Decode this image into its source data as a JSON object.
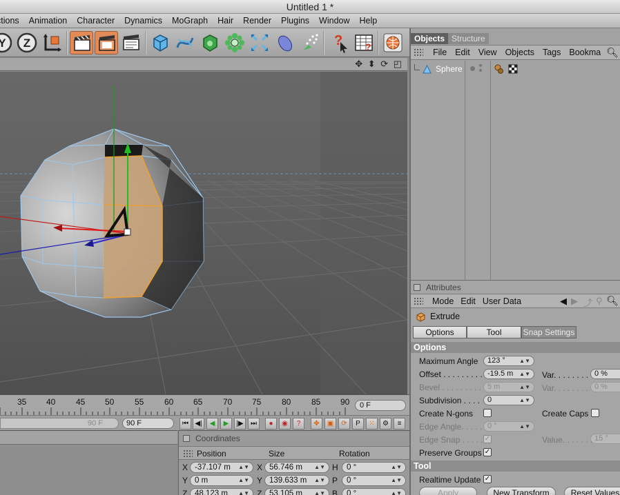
{
  "window": {
    "title": "Untitled 1 *"
  },
  "menubar": [
    "ctions",
    "Animation",
    "Character",
    "Dynamics",
    "MoGraph",
    "Hair",
    "Render",
    "Plugins",
    "Window",
    "Help"
  ],
  "toolbar": {
    "icons": [
      "y-axis-lock-icon",
      "z-axis-lock-icon",
      "world-coordinates-icon",
      "render-view-icon",
      "render-picture-viewer-icon",
      "render-settings-icon",
      "cube-primitive-icon",
      "spline-icon",
      "nurbs-icon",
      "array-icon",
      "deformer-icon",
      "scene-icon",
      "light-icon",
      "help-pointer-icon",
      "layout-icon",
      "web-icon"
    ],
    "y_label": "Y",
    "z_label": "Z"
  },
  "viewport": {
    "nav_icons": "✥ ⬍ ⟳ ◰"
  },
  "timeline": {
    "ticks": [
      "35",
      "40",
      "45",
      "50",
      "55",
      "60",
      "65",
      "70",
      "75",
      "80",
      "85",
      "90"
    ],
    "current_frame": "0 F",
    "slider_value": "90 F",
    "end_frame": "90 F"
  },
  "coordinates": {
    "title": "Coordinates",
    "headers": {
      "position": "Position",
      "size": "Size",
      "rotation": "Rotation"
    },
    "rows": [
      {
        "axis": "X",
        "position": "-37.107 m",
        "size_axis": "X",
        "size": "56.746 m",
        "rot_axis": "H",
        "rotation": "0 °"
      },
      {
        "axis": "Y",
        "position": "0 m",
        "size_axis": "Y",
        "size": "139.633 m",
        "rot_axis": "P",
        "rotation": "0 °"
      },
      {
        "axis": "Z",
        "position": "48.123 m",
        "size_axis": "Z",
        "size": "53.105 m",
        "rot_axis": "B",
        "rotation": "0 °"
      }
    ]
  },
  "objects": {
    "tabs": [
      "Objects",
      "Structure"
    ],
    "menu": [
      "File",
      "Edit",
      "View",
      "Objects",
      "Tags",
      "Bookma"
    ],
    "items": [
      {
        "name": "Sphere"
      }
    ]
  },
  "attributes": {
    "title": "Attributes",
    "menu": [
      "Mode",
      "Edit",
      "User Data"
    ],
    "tool_name": "Extrude",
    "tabs": [
      "Options",
      "Tool",
      "Snap Settings"
    ],
    "options_header": "Options",
    "tool_header": "Tool",
    "fields": {
      "max_angle_label": "Maximum Angle",
      "max_angle": "123 °",
      "offset_label": "Offset . . . . . . . . .",
      "offset": "-19.5 m",
      "var1_label": "Var. . . . . . . .",
      "var1": "0 %",
      "bevel_label": "Bevel . . . . . . . . .",
      "bevel": "5 m",
      "var2_label": "Var. . . . . . . .",
      "var2": "0 %",
      "subdivision_label": "Subdivision . . . .",
      "subdivision": "0",
      "create_ngons_label": "Create N-gons",
      "create_caps_label": "Create Caps",
      "edge_angle_label": "Edge Angle. . . . .",
      "edge_angle": "0 °",
      "edge_snap_label": "Edge Snap . . . . .",
      "value_label": "Value. . . . . . .",
      "value": "15 °",
      "preserve_groups_label": "Preserve Groups",
      "realtime_update_label": "Realtime Update"
    },
    "buttons": {
      "apply": "Apply",
      "new_transform": "New Transform",
      "reset_values": "Reset Values"
    }
  }
}
